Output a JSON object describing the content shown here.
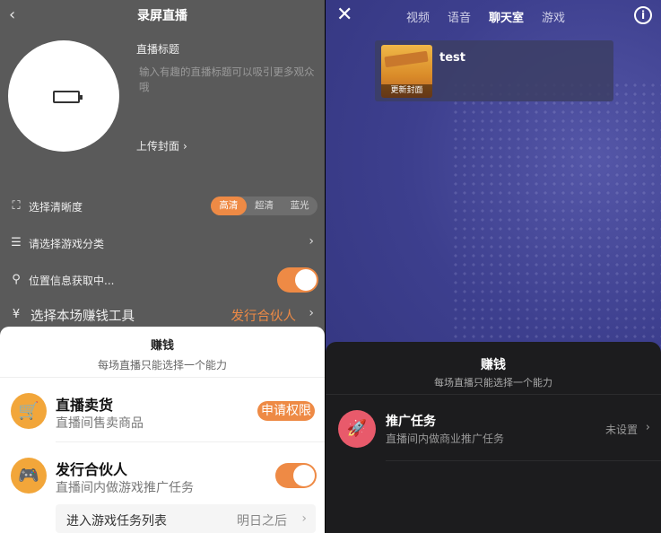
{
  "left": {
    "header": {
      "back": "‹",
      "title": "录屏直播"
    },
    "cover": {
      "upload_label": "上传封面",
      "upload_chevron": "›"
    },
    "live_title": {
      "label": "直播标题",
      "placeholder": "输入有趣的直播标题可以吸引更多观众哦"
    },
    "quality": {
      "label": "选择清晰度",
      "options": [
        "高清",
        "超清",
        "蓝光"
      ],
      "selected": "高清"
    },
    "game_category": {
      "label": "请选择游戏分类",
      "chevron": "›"
    },
    "location": {
      "label": "位置信息获取中...",
      "enabled": true
    },
    "earn_tool": {
      "label": "选择本场赚钱工具",
      "value": "发行合伙人",
      "chevron": "›"
    },
    "sheet": {
      "title": "赚钱",
      "subtitle": "每场直播只能选择一个能力",
      "options": [
        {
          "title": "直播卖货",
          "desc": "直播间售卖商品",
          "action": "申请权限",
          "icon": "cart-icon"
        },
        {
          "title": "发行合伙人",
          "desc": "直播间内做游戏推广任务",
          "enabled": true,
          "icon": "gamepad-icon"
        }
      ],
      "task_row": {
        "label": "进入游戏任务列表",
        "value": "明日之后",
        "chevron": "›"
      }
    }
  },
  "right": {
    "close": "✕",
    "tabs": [
      "视频",
      "语音",
      "聊天室",
      "游戏"
    ],
    "active_tab": "聊天室",
    "info": "i",
    "room": {
      "name": "test",
      "update_cover": "更新封面"
    },
    "sheet": {
      "title": "赚钱",
      "subtitle": "每场直播只能选择一个能力",
      "option": {
        "title": "推广任务",
        "desc": "直播间内做商业推广任务",
        "status": "未设置",
        "chevron": "›",
        "icon": "rocket-icon"
      }
    }
  },
  "colors": {
    "accent": "#ee8a45",
    "right_bg": "#3d3f8e",
    "promo_icon": "#e85a6b"
  }
}
